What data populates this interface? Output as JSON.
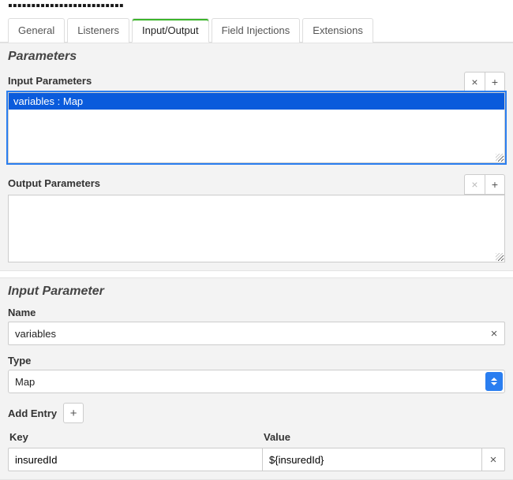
{
  "header_partial": "▪▪▪▪▪▪▪▪▪▪▪▪▪▪▪▪▪▪▪▪▪▪▪▪▪",
  "tabs": {
    "general": "General",
    "listeners": "Listeners",
    "input_output": "Input/Output",
    "field_injections": "Field Injections",
    "extensions": "Extensions",
    "active": "input_output"
  },
  "parameters_section": {
    "title": "Parameters",
    "input_label": "Input Parameters",
    "output_label": "Output Parameters",
    "input_items": [
      {
        "label": "variables : Map",
        "selected": true
      }
    ],
    "output_items": []
  },
  "icons": {
    "remove": "×",
    "add": "+"
  },
  "detail_section": {
    "title": "Input Parameter",
    "name_label": "Name",
    "name_value": "variables",
    "type_label": "Type",
    "type_value": "Map",
    "add_entry_label": "Add Entry",
    "table": {
      "key_header": "Key",
      "value_header": "Value",
      "rows": [
        {
          "key": "insuredId",
          "value": "${insuredId}"
        }
      ]
    }
  }
}
